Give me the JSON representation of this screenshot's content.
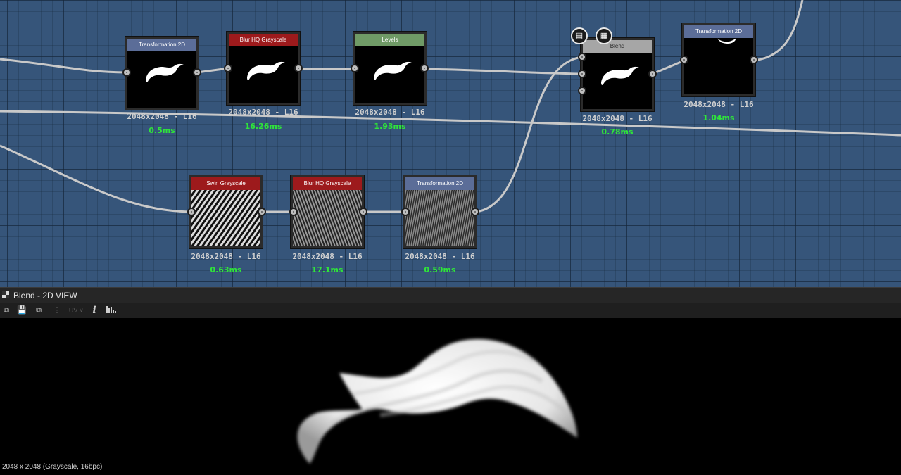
{
  "nodes": {
    "n1": {
      "title": "Transformation 2D",
      "res": "2048x2048 - L16",
      "time": "0.5ms"
    },
    "n2": {
      "title": "Blur HQ Grayscale",
      "res": "2048x2048 - L16",
      "time": "16.26ms"
    },
    "n3": {
      "title": "Levels",
      "res": "2048x2048 - L16",
      "time": "1.93ms"
    },
    "n4": {
      "title": "Blend",
      "res": "2048x2048 - L16",
      "time": "0.78ms"
    },
    "n5": {
      "title": "Transformation 2D",
      "res": "2048x2048 - L16",
      "time": "1.04ms"
    },
    "n6": {
      "title": "Swirl Grayscale",
      "res": "2048x2048 - L16",
      "time": "0.63ms"
    },
    "n7": {
      "title": "Blur HQ Grayscale",
      "res": "2048x2048 - L16",
      "time": "17.1ms"
    },
    "n8": {
      "title": "Transformation 2D",
      "res": "2048x2048 - L16",
      "time": "0.59ms"
    }
  },
  "node_buttons": {
    "doc_icon": "document-icon",
    "checker_icon": "checker-icon"
  },
  "view": {
    "title": "Blend - 2D VIEW",
    "toolbar": {
      "uv_label": "UV",
      "info_label": "i"
    },
    "status": "2048 x 2048 (Grayscale, 16bpc)"
  },
  "colors": {
    "graph_bg": "#36557a",
    "header_blue": "#5b6d98",
    "header_red": "#9d1a1c",
    "header_green": "#6f9a66",
    "header_gray": "#a6a6a6",
    "time_green": "#2fe53a"
  }
}
